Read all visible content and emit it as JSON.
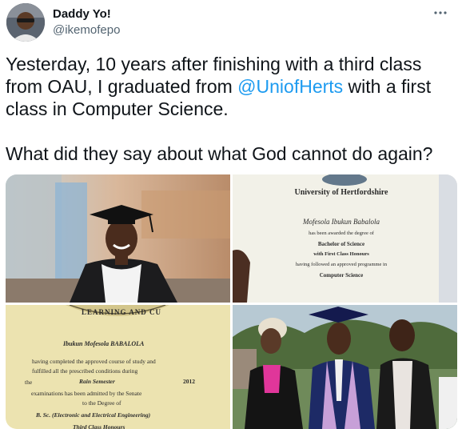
{
  "author": {
    "display_name": "Daddy Yo!",
    "handle": "@ikemofepo",
    "avatar_icon": "user-avatar"
  },
  "more_icon": "more-horizontal-icon",
  "tweet": {
    "line1": "Yesterday, 10 years after finishing with a third class from OAU, I graduated from ",
    "mention": "@UniofHerts",
    "line1_end": " with a first class in Computer Science.",
    "line2": "What did they say about what God cannot do again?"
  },
  "media": {
    "certificate_herts": {
      "university": "University of Hertfordshire",
      "name": "Mofesola Ibukun Babalola",
      "awarded": "has been awarded the degree of",
      "degree": "Bachelor of Science",
      "honours": "with First Class Honours",
      "followed": "having followed an approved programme in",
      "programme": "Computer Science"
    },
    "certificate_oau": {
      "seal_text": "LEARNING AND CU",
      "name": "Ibukun Mofesola BABALOLA",
      "line1": "having completed the approved course of study and",
      "line2": "fulfilled all the prescribed conditions during",
      "the": "the",
      "semester": "Rain Semester",
      "year": "2012",
      "line3": "examinations has been admitted by the Senate",
      "line4": "to the Degree of",
      "degree": "B. Sc. (Electronic and Electrical Engineering)",
      "class": "Third Class Honours"
    }
  },
  "colors": {
    "text": "#0f1419",
    "secondary": "#536471",
    "link": "#1d9bf0"
  }
}
